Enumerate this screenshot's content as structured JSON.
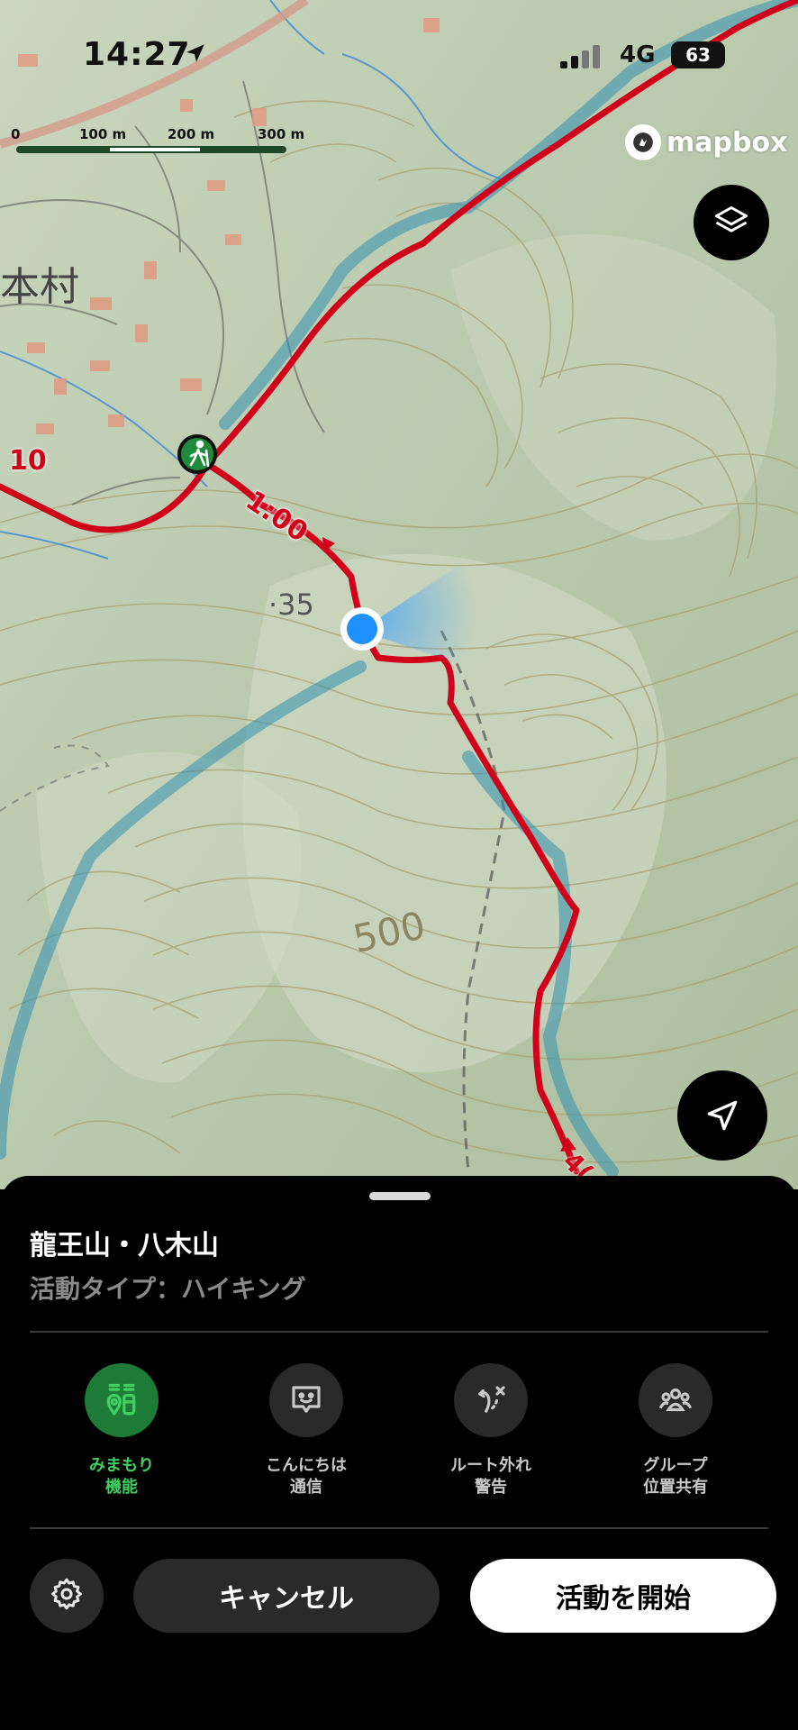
{
  "status_bar": {
    "time": "14:27",
    "network": "4G",
    "battery": "63"
  },
  "map": {
    "scale_labels": [
      "0",
      "100 m",
      "200 m",
      "300 m"
    ],
    "attribution": "mapbox",
    "labels": {
      "village": "本村",
      "route_number": "10",
      "route_time": "1:00",
      "elevation_point": "·35",
      "contour_label": "500",
      "route_time_2": "4("
    },
    "colors": {
      "route": "#d0021b",
      "user_location": "#1e90ff",
      "trailhead": "#1e8c3a"
    }
  },
  "sheet": {
    "title": "龍王山・八木山",
    "subtitle": "活動タイプ：ハイキング",
    "features": [
      {
        "label": "みまもり\n機能",
        "icon": "watch-over-icon",
        "active": true
      },
      {
        "label": "こんにちは\n通信",
        "icon": "greeting-icon",
        "active": false
      },
      {
        "label": "ルート外れ\n警告",
        "icon": "off-route-icon",
        "active": false
      },
      {
        "label": "グループ\n位置共有",
        "icon": "group-icon",
        "active": false
      }
    ],
    "cancel_label": "キャンセル",
    "start_label": "活動を開始"
  }
}
